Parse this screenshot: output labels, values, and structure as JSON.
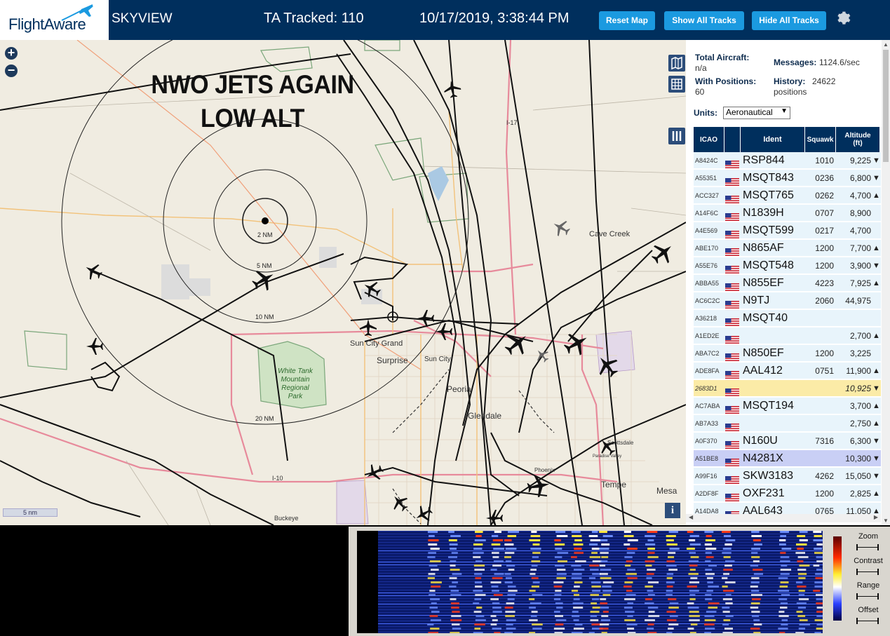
{
  "header": {
    "logo_text": "FlightAware",
    "app_name": "SKYVIEW",
    "tracked": "TA Tracked: 110",
    "datetime": "10/17/2019, 3:38:44 PM",
    "buttons": {
      "reset": "Reset Map",
      "show_all": "Show All Tracks",
      "hide_all": "Hide All Tracks"
    },
    "settings_icon": "gear-icon"
  },
  "map": {
    "overlay_text": [
      "NWO JETS AGAIN",
      "LOW ALT"
    ],
    "zoom_in": "+",
    "zoom_out": "−",
    "range_rings": [
      "2 NM",
      "5 NM",
      "10 NM",
      "20 NM"
    ],
    "places": [
      {
        "name": "Cave Creek"
      },
      {
        "name": "Sun City Grand"
      },
      {
        "name": "Surprise"
      },
      {
        "name": "Sun City"
      },
      {
        "name": "Peoria"
      },
      {
        "name": "Glendale"
      },
      {
        "name": "Tempe"
      },
      {
        "name": "Mesa"
      },
      {
        "name": "Buckeye"
      },
      {
        "name": "White Tank Mountain Regional Park"
      },
      {
        "name": "I-17"
      },
      {
        "name": "I-10"
      },
      {
        "name": "Phoenix"
      },
      {
        "name": "Scottsdale"
      },
      {
        "name": "Paradise Valley"
      }
    ],
    "scale": "5 nm",
    "info": "i"
  },
  "panel": {
    "total_aircraft_label": "Total Aircraft:",
    "total_aircraft_value": "n/a",
    "with_positions_label": "With Positions:",
    "with_positions_value": "60",
    "messages_label": "Messages:",
    "messages_value": "1124.6/sec",
    "history_label": "History:",
    "history_value": "24622",
    "history_unit": "positions",
    "units_label": "Units:",
    "units_value": "Aeronautical",
    "columns": {
      "icao": "ICAO",
      "ident": "Ident",
      "squawk": "Squawk",
      "altitude": "Altitude",
      "altitude_unit": "(ft)"
    },
    "rows": [
      {
        "icao": "A8424C",
        "ident": "RSP844",
        "squawk": "1010",
        "alt": "9,225",
        "trend": "▼",
        "state": ""
      },
      {
        "icao": "A55351",
        "ident": "MSQT843",
        "squawk": "0236",
        "alt": "6,800",
        "trend": "▼",
        "state": ""
      },
      {
        "icao": "ACC327",
        "ident": "MSQT765",
        "squawk": "0262",
        "alt": "4,700",
        "trend": "▲",
        "state": ""
      },
      {
        "icao": "A14F6C",
        "ident": "N1839H",
        "squawk": "0707",
        "alt": "8,900",
        "trend": "",
        "state": ""
      },
      {
        "icao": "A4E569",
        "ident": "MSQT599",
        "squawk": "0217",
        "alt": "4,700",
        "trend": "",
        "state": ""
      },
      {
        "icao": "ABE170",
        "ident": "N865AF",
        "squawk": "1200",
        "alt": "7,700",
        "trend": "▲",
        "state": ""
      },
      {
        "icao": "A55E76",
        "ident": "MSQT548",
        "squawk": "1200",
        "alt": "3,900",
        "trend": "▼",
        "state": ""
      },
      {
        "icao": "ABBA55",
        "ident": "N855EF",
        "squawk": "4223",
        "alt": "7,925",
        "trend": "▲",
        "state": ""
      },
      {
        "icao": "AC6C2C",
        "ident": "N9TJ",
        "squawk": "2060",
        "alt": "44,975",
        "trend": "",
        "state": ""
      },
      {
        "icao": "A36218",
        "ident": "MSQT40",
        "squawk": "",
        "alt": "",
        "trend": "",
        "state": ""
      },
      {
        "icao": "A1ED2E",
        "ident": "",
        "squawk": "",
        "alt": "2,700",
        "trend": "▲",
        "state": ""
      },
      {
        "icao": "ABA7C2",
        "ident": "N850EF",
        "squawk": "1200",
        "alt": "3,225",
        "trend": "",
        "state": ""
      },
      {
        "icao": "ADE8FA",
        "ident": "AAL412",
        "squawk": "0751",
        "alt": "11,900",
        "trend": "▲",
        "state": ""
      },
      {
        "icao": "2683D1",
        "ident": "",
        "squawk": "",
        "alt": "10,925",
        "trend": "▼",
        "state": "sel"
      },
      {
        "icao": "AC7ABA",
        "ident": "MSQT194",
        "squawk": "",
        "alt": "3,700",
        "trend": "▲",
        "state": ""
      },
      {
        "icao": "AB7A33",
        "ident": "",
        "squawk": "",
        "alt": "2,750",
        "trend": "▲",
        "state": ""
      },
      {
        "icao": "A0F370",
        "ident": "N160U",
        "squawk": "7316",
        "alt": "6,300",
        "trend": "▼",
        "state": ""
      },
      {
        "icao": "A51BE8",
        "ident": "N4281X",
        "squawk": "",
        "alt": "10,300",
        "trend": "▼",
        "state": "hl"
      },
      {
        "icao": "A99F16",
        "ident": "SKW3183",
        "squawk": "4262",
        "alt": "15,050",
        "trend": "▼",
        "state": ""
      },
      {
        "icao": "A2DF8F",
        "ident": "OXF231",
        "squawk": "1200",
        "alt": "2,825",
        "trend": "▲",
        "state": ""
      },
      {
        "icao": "A14DA8",
        "ident": "AAL643",
        "squawk": "0765",
        "alt": "11,050",
        "trend": "▲",
        "state": ""
      }
    ]
  },
  "sdr": {
    "controls": [
      "Zoom",
      "Contrast",
      "Range",
      "Offset"
    ]
  },
  "colors": {
    "header_bg": "#002f5d",
    "button": "#1b9ae0",
    "row": "#e8f4fb",
    "row_selected": "#fbeba7",
    "row_highlight": "#c9cff5"
  }
}
